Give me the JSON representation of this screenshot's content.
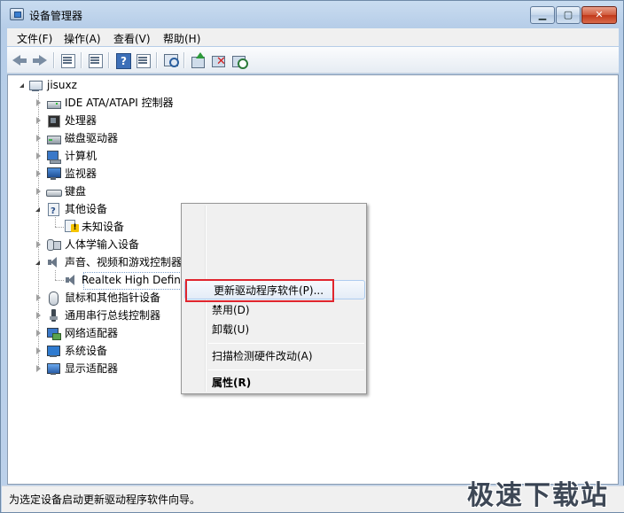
{
  "window": {
    "title": "设备管理器",
    "min_symbol": "▁",
    "max_symbol": "▢",
    "close_symbol": "✕"
  },
  "menubar": [
    {
      "label": "文件(F)"
    },
    {
      "label": "操作(A)"
    },
    {
      "label": "查看(V)"
    },
    {
      "label": "帮助(H)"
    }
  ],
  "toolbar": {
    "icons": [
      "back-icon",
      "forward-icon",
      "properties-icon",
      "list-icon",
      "help-icon",
      "view-icon",
      "scan-hardware-icon",
      "update-driver-icon",
      "uninstall-icon",
      "enable-icon"
    ]
  },
  "tree": {
    "root": "jisuxz",
    "items": [
      {
        "label": "IDE ATA/ATAPI 控制器",
        "icon": "ide-controller-icon"
      },
      {
        "label": "处理器",
        "icon": "processor-icon"
      },
      {
        "label": "磁盘驱动器",
        "icon": "disk-drive-icon"
      },
      {
        "label": "计算机",
        "icon": "computer-icon"
      },
      {
        "label": "监视器",
        "icon": "monitor-icon"
      },
      {
        "label": "键盘",
        "icon": "keyboard-icon"
      },
      {
        "label": "其他设备",
        "icon": "other-devices-icon"
      },
      {
        "label": "未知设备",
        "icon": "unknown-device-warning-icon"
      },
      {
        "label": "人体学输入设备",
        "icon": "hid-icon"
      },
      {
        "label": "声音、视频和游戏控制器",
        "icon": "sound-icon"
      },
      {
        "label": "Realtek High Definition Audio",
        "icon": "speaker-icon"
      },
      {
        "label": "鼠标和其他指针设备",
        "icon": "mouse-icon"
      },
      {
        "label": "通用串行总线控制器",
        "icon": "usb-icon"
      },
      {
        "label": "网络适配器",
        "icon": "network-adapter-icon"
      },
      {
        "label": "系统设备",
        "icon": "system-devices-icon"
      },
      {
        "label": "显示适配器",
        "icon": "display-adapter-icon"
      }
    ],
    "selected_visible_text": "Realtek High Definiti",
    "selected_tail": "udi"
  },
  "context_menu": {
    "items": [
      {
        "label": "更新驱动程序软件(P)..."
      },
      {
        "label": "禁用(D)"
      },
      {
        "label": "卸载(U)"
      },
      {
        "label": "扫描检测硬件改动(A)"
      },
      {
        "label": "属性(R)"
      }
    ]
  },
  "statusbar": {
    "text": "为选定设备启动更新驱动程序软件向导。"
  },
  "watermark": "极速下载站",
  "colors": {
    "highlight_border": "#e0252e",
    "titlebar": "#c9dcf0",
    "close_button": "#c1391a"
  }
}
